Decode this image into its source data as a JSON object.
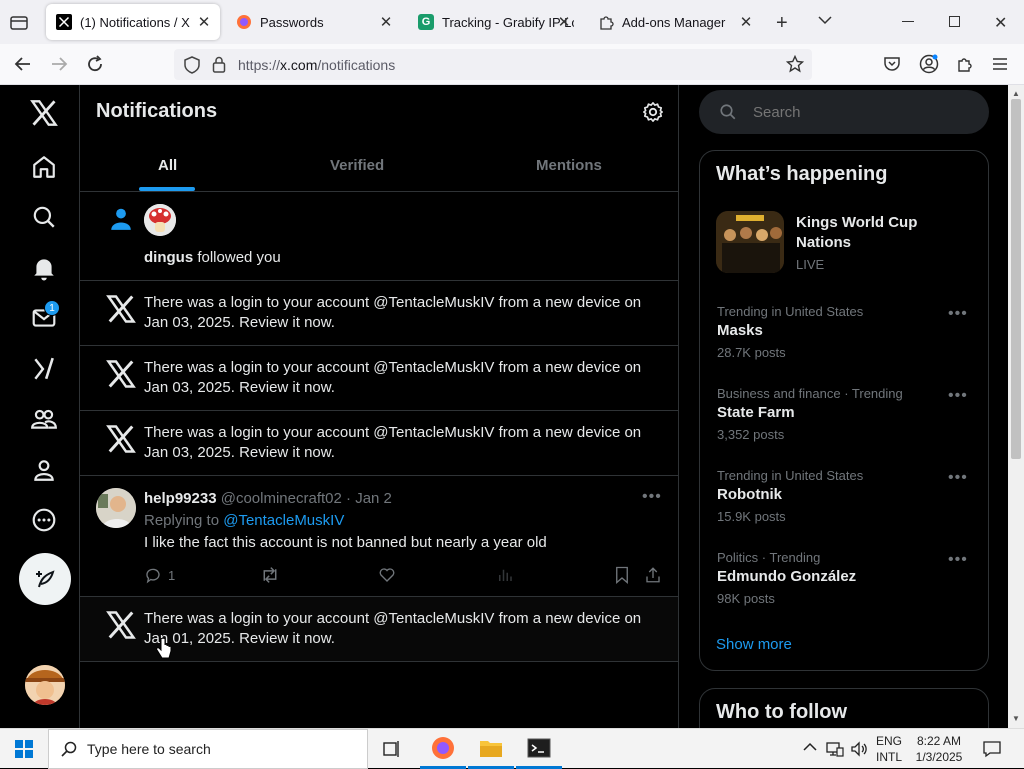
{
  "browser": {
    "tabs": [
      {
        "title": "(1) Notifications / X",
        "active": true
      },
      {
        "title": "Passwords",
        "active": false
      },
      {
        "title": "Tracking - Grabify IP Lo",
        "active": false
      },
      {
        "title": "Add-ons Manager",
        "active": false
      }
    ],
    "url_prefix": "https://",
    "url_host": "x.com",
    "url_path": "/notifications"
  },
  "sidebar": {
    "messages_badge": "1"
  },
  "header": {
    "title": "Notifications",
    "tabs": [
      {
        "label": "All",
        "selected": true
      },
      {
        "label": "Verified",
        "selected": false
      },
      {
        "label": "Mentions",
        "selected": false
      }
    ]
  },
  "notifications": {
    "follow": {
      "user": "dingus",
      "text": " followed you"
    },
    "login_1": "There was a login to your account @TentacleMuskIV from a new device on Jan 03, 2025. Review it now.",
    "login_2": "There was a login to your account @TentacleMuskIV from a new device on Jan 03, 2025. Review it now.",
    "login_3": "There was a login to your account @TentacleMuskIV from a new device on Jan 03, 2025. Review it now.",
    "reply": {
      "name": "help99233",
      "handle": "@coolminecraft02",
      "sep": " · ",
      "date": "Jan 2",
      "replying_label": "Replying to ",
      "replying_to": "@TentacleMuskIV",
      "body": "I like the fact this account is not banned but nearly a year old",
      "reply_count": "1"
    },
    "login_4": "There was a login to your account @TentacleMuskIV from a new device on Jan 01, 2025. Review it now."
  },
  "search": {
    "placeholder": "Search"
  },
  "whats_happening": {
    "title": "What’s happening",
    "featured": {
      "title": "Kings World Cup Nations",
      "status": "LIVE"
    },
    "trends": [
      {
        "meta": "Trending in United States",
        "name": "Masks",
        "count": "28.7K posts"
      },
      {
        "meta": "Business and finance · Trending",
        "name": "State Farm",
        "count": "3,352 posts"
      },
      {
        "meta": "Trending in United States",
        "name": "Robotnik",
        "count": "15.9K posts"
      },
      {
        "meta": "Politics · Trending",
        "name": "Edmundo González",
        "count": "98K posts"
      }
    ],
    "show_more": "Show more"
  },
  "who_to_follow": {
    "title": "Who to follow"
  },
  "taskbar": {
    "search_placeholder": "Type here to search",
    "lang_1": "ENG",
    "lang_2": "INTL",
    "time": "8:22 AM",
    "date": "1/3/2025"
  },
  "colors": {
    "accent": "#1d9bf0",
    "bg": "#000000",
    "border": "#2f3336",
    "muted": "#71767b"
  }
}
